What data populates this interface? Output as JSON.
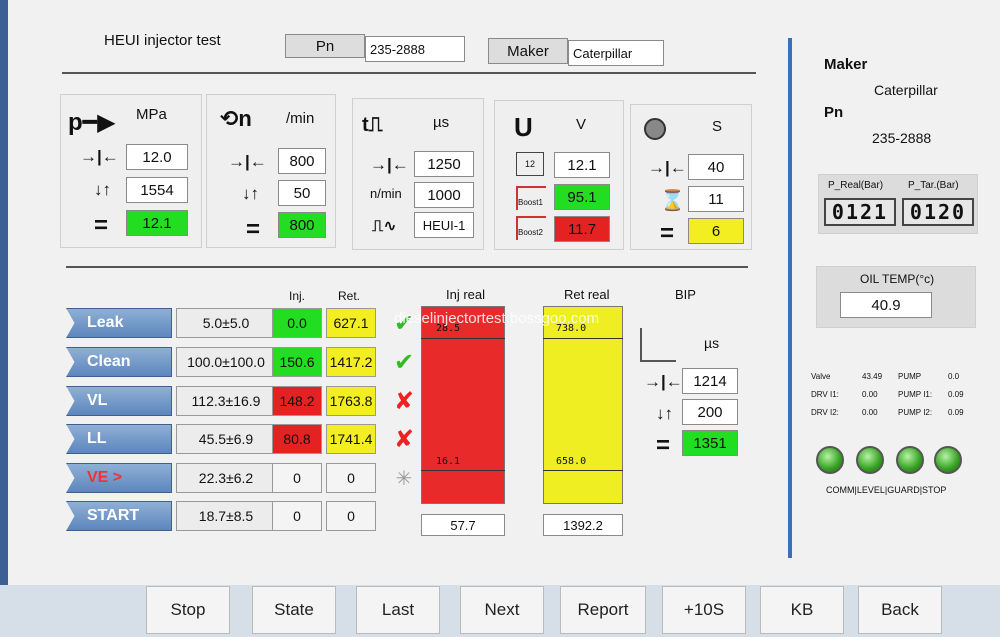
{
  "header": {
    "title": "HEUI injector test",
    "pn_label": "Pn",
    "pn_value": "235-2888",
    "maker_label": "Maker",
    "maker_value": "Caterpillar"
  },
  "pressure": {
    "unit": "MPa",
    "set": "12.0",
    "max": "1554",
    "actual": "12.1"
  },
  "speed": {
    "unit": "/min",
    "set": "800",
    "step": "50",
    "actual": "800"
  },
  "pulse": {
    "unit": "µs",
    "width": "1250",
    "freq_label": "n/min",
    "freq": "1000",
    "mode": "HEUI-1"
  },
  "voltage": {
    "unit": "V",
    "supply": "12.1",
    "boost1": "95.1",
    "boost2": "11.7",
    "supply_label": "12",
    "boost1_label": "Boost1",
    "boost2_label": "Boost2"
  },
  "time": {
    "unit": "S",
    "set": "40",
    "remaining": "11",
    "count": "6"
  },
  "results": {
    "inj_header": "Inj.",
    "ret_header": "Ret.",
    "rows": [
      {
        "name": "Leak",
        "spec": "5.0±5.0",
        "inj": "0.0",
        "ret": "627.1",
        "mark": "✔"
      },
      {
        "name": "Clean",
        "spec": "100.0±100.0",
        "inj": "150.6",
        "ret": "1417.2",
        "mark": "✔"
      },
      {
        "name": "VL",
        "spec": "112.3±16.9",
        "inj": "148.2",
        "ret": "1763.8",
        "mark": "✘"
      },
      {
        "name": "LL",
        "spec": "45.5±6.9",
        "inj": "80.8",
        "ret": "1741.4",
        "mark": "✘"
      },
      {
        "name": "VE >",
        "spec": "22.3±6.2",
        "inj": "0",
        "ret": "0",
        "mark": "✳"
      },
      {
        "name": "START",
        "spec": "18.7±8.5",
        "inj": "0",
        "ret": "0",
        "mark": ""
      }
    ]
  },
  "inj_real": {
    "label": "Inj real",
    "top": "28.5",
    "bottom": "16.1",
    "value": "57.7"
  },
  "ret_real": {
    "label": "Ret real",
    "top": "738.0",
    "bottom": "658.0",
    "value": "1392.2"
  },
  "bip": {
    "label": "BIP",
    "unit": "µs",
    "set": "1214",
    "step": "200",
    "actual": "1351"
  },
  "side": {
    "maker_label": "Maker",
    "maker_value": "Caterpillar",
    "pn_label": "Pn",
    "pn_value": "235-2888",
    "p_real_label": "P_Real(Bar)",
    "p_tar_label": "P_Tar.(Bar)",
    "p_real": "0121",
    "p_tar": "0120",
    "oil_temp_label": "OIL TEMP(°c)",
    "oil_temp": "40.9",
    "valve_label": "Valve",
    "valve": "43.49",
    "pump_label": "PUMP",
    "pump": "0.0",
    "drv1_label": "DRV I1:",
    "drv1": "0.00",
    "pump1_label": "PUMP I1:",
    "pump1": "0.09",
    "drv2_label": "DRV I2:",
    "drv2": "0.00",
    "pump2_label": "PUMP I2:",
    "pump2": "0.09",
    "leds_label": "COMM|LEVEL|GUARD|STOP"
  },
  "watermark": "dieselinjectortest.bossgoo.com",
  "footer": {
    "buttons": [
      "Stop",
      "State",
      "Last",
      "Next",
      "Report",
      "+10S",
      "KB",
      "Back"
    ]
  },
  "colors": {
    "ok": "#22dd22",
    "warn": "#f2ee22",
    "bad": "#e52222"
  }
}
